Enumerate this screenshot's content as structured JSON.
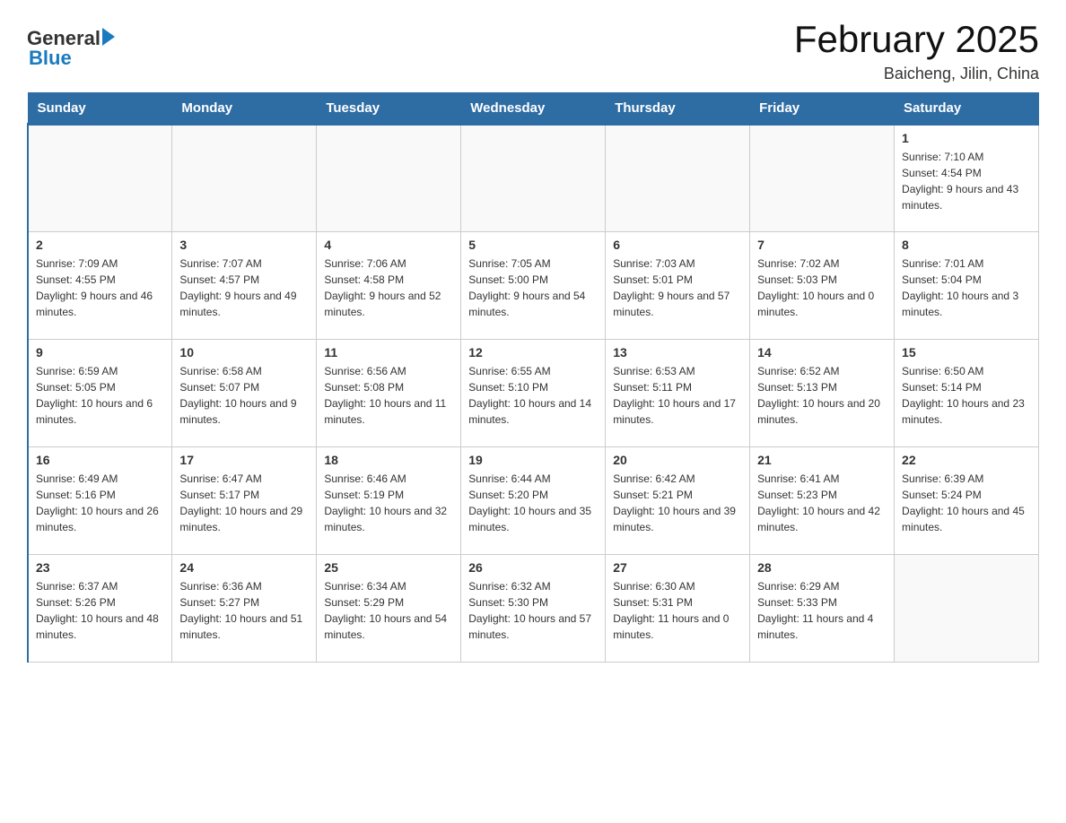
{
  "header": {
    "month_title": "February 2025",
    "location": "Baicheng, Jilin, China",
    "logo_general": "General",
    "logo_blue": "Blue"
  },
  "weekdays": [
    "Sunday",
    "Monday",
    "Tuesday",
    "Wednesday",
    "Thursday",
    "Friday",
    "Saturday"
  ],
  "weeks": [
    [
      {
        "day": "",
        "info": ""
      },
      {
        "day": "",
        "info": ""
      },
      {
        "day": "",
        "info": ""
      },
      {
        "day": "",
        "info": ""
      },
      {
        "day": "",
        "info": ""
      },
      {
        "day": "",
        "info": ""
      },
      {
        "day": "1",
        "info": "Sunrise: 7:10 AM\nSunset: 4:54 PM\nDaylight: 9 hours and 43 minutes."
      }
    ],
    [
      {
        "day": "2",
        "info": "Sunrise: 7:09 AM\nSunset: 4:55 PM\nDaylight: 9 hours and 46 minutes."
      },
      {
        "day": "3",
        "info": "Sunrise: 7:07 AM\nSunset: 4:57 PM\nDaylight: 9 hours and 49 minutes."
      },
      {
        "day": "4",
        "info": "Sunrise: 7:06 AM\nSunset: 4:58 PM\nDaylight: 9 hours and 52 minutes."
      },
      {
        "day": "5",
        "info": "Sunrise: 7:05 AM\nSunset: 5:00 PM\nDaylight: 9 hours and 54 minutes."
      },
      {
        "day": "6",
        "info": "Sunrise: 7:03 AM\nSunset: 5:01 PM\nDaylight: 9 hours and 57 minutes."
      },
      {
        "day": "7",
        "info": "Sunrise: 7:02 AM\nSunset: 5:03 PM\nDaylight: 10 hours and 0 minutes."
      },
      {
        "day": "8",
        "info": "Sunrise: 7:01 AM\nSunset: 5:04 PM\nDaylight: 10 hours and 3 minutes."
      }
    ],
    [
      {
        "day": "9",
        "info": "Sunrise: 6:59 AM\nSunset: 5:05 PM\nDaylight: 10 hours and 6 minutes."
      },
      {
        "day": "10",
        "info": "Sunrise: 6:58 AM\nSunset: 5:07 PM\nDaylight: 10 hours and 9 minutes."
      },
      {
        "day": "11",
        "info": "Sunrise: 6:56 AM\nSunset: 5:08 PM\nDaylight: 10 hours and 11 minutes."
      },
      {
        "day": "12",
        "info": "Sunrise: 6:55 AM\nSunset: 5:10 PM\nDaylight: 10 hours and 14 minutes."
      },
      {
        "day": "13",
        "info": "Sunrise: 6:53 AM\nSunset: 5:11 PM\nDaylight: 10 hours and 17 minutes."
      },
      {
        "day": "14",
        "info": "Sunrise: 6:52 AM\nSunset: 5:13 PM\nDaylight: 10 hours and 20 minutes."
      },
      {
        "day": "15",
        "info": "Sunrise: 6:50 AM\nSunset: 5:14 PM\nDaylight: 10 hours and 23 minutes."
      }
    ],
    [
      {
        "day": "16",
        "info": "Sunrise: 6:49 AM\nSunset: 5:16 PM\nDaylight: 10 hours and 26 minutes."
      },
      {
        "day": "17",
        "info": "Sunrise: 6:47 AM\nSunset: 5:17 PM\nDaylight: 10 hours and 29 minutes."
      },
      {
        "day": "18",
        "info": "Sunrise: 6:46 AM\nSunset: 5:19 PM\nDaylight: 10 hours and 32 minutes."
      },
      {
        "day": "19",
        "info": "Sunrise: 6:44 AM\nSunset: 5:20 PM\nDaylight: 10 hours and 35 minutes."
      },
      {
        "day": "20",
        "info": "Sunrise: 6:42 AM\nSunset: 5:21 PM\nDaylight: 10 hours and 39 minutes."
      },
      {
        "day": "21",
        "info": "Sunrise: 6:41 AM\nSunset: 5:23 PM\nDaylight: 10 hours and 42 minutes."
      },
      {
        "day": "22",
        "info": "Sunrise: 6:39 AM\nSunset: 5:24 PM\nDaylight: 10 hours and 45 minutes."
      }
    ],
    [
      {
        "day": "23",
        "info": "Sunrise: 6:37 AM\nSunset: 5:26 PM\nDaylight: 10 hours and 48 minutes."
      },
      {
        "day": "24",
        "info": "Sunrise: 6:36 AM\nSunset: 5:27 PM\nDaylight: 10 hours and 51 minutes."
      },
      {
        "day": "25",
        "info": "Sunrise: 6:34 AM\nSunset: 5:29 PM\nDaylight: 10 hours and 54 minutes."
      },
      {
        "day": "26",
        "info": "Sunrise: 6:32 AM\nSunset: 5:30 PM\nDaylight: 10 hours and 57 minutes."
      },
      {
        "day": "27",
        "info": "Sunrise: 6:30 AM\nSunset: 5:31 PM\nDaylight: 11 hours and 0 minutes."
      },
      {
        "day": "28",
        "info": "Sunrise: 6:29 AM\nSunset: 5:33 PM\nDaylight: 11 hours and 4 minutes."
      },
      {
        "day": "",
        "info": ""
      }
    ]
  ]
}
